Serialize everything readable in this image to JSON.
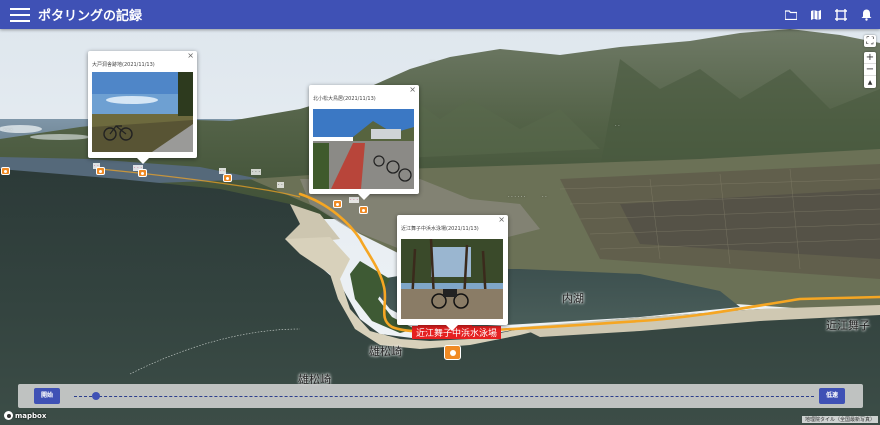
{
  "app": {
    "title": "ポタリングの記録"
  },
  "header_icons": [
    "folder-icon",
    "map-icon",
    "crop-icon",
    "bell-icon"
  ],
  "popups": [
    {
      "title": "大戸洞舎跡地(2021/11/13)"
    },
    {
      "title": "北小松大鳥居(2021/11/13)"
    },
    {
      "title": "近江舞子中浜水泳場(2021/11/13)"
    }
  ],
  "map": {
    "labels": {
      "uchiko": "内湖",
      "yuumatsuzaki": "雄松崎",
      "yuumatsuzaki2": "雄松崎",
      "omimaiko": "近江舞子",
      "selected_spot": "近江舞子中浜水泳場"
    }
  },
  "controls": {
    "fullscreen": "⛶",
    "zoom_in": "+",
    "zoom_out": "−",
    "compass": "▲"
  },
  "playback": {
    "start_label": "開始",
    "slow_label": "低速",
    "progress": 0.03
  },
  "footer": {
    "logo_text": "mapbox",
    "attribution": "地理院タイル（全国最新写真）"
  },
  "colors": {
    "primary": "#3f51b5",
    "route": "#f5a623",
    "marker": "#f08a24"
  }
}
